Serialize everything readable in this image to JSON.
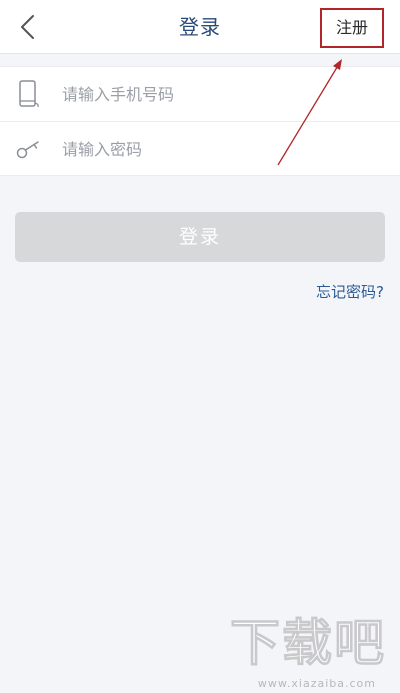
{
  "header": {
    "title": "登录",
    "register_label": "注册"
  },
  "form": {
    "phone_placeholder": "请输入手机号码",
    "phone_value": "",
    "password_placeholder": "请输入密码",
    "password_value": ""
  },
  "login_button_label": "登录",
  "forgot_password_label": "忘记密码?",
  "watermark": {
    "main": "下载吧",
    "sub": "www.xiazaiba.com"
  },
  "colors": {
    "title": "#2a4a78",
    "annotation_red": "#b0262b",
    "link": "#2d5a95",
    "button_disabled": "#d7d8da"
  },
  "icons": {
    "back": "chevron-left-icon",
    "phone": "phone-icon",
    "key": "key-icon"
  }
}
